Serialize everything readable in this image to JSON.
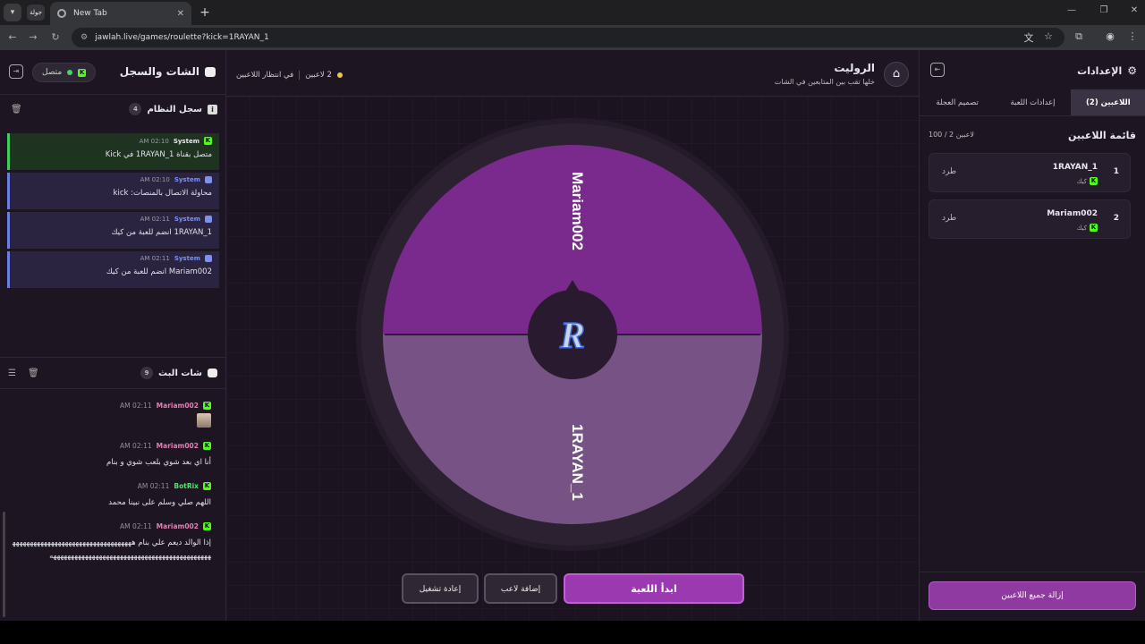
{
  "browser": {
    "pinned_tab_label": "جولة",
    "tab_title": "New Tab",
    "url": "jawlah.live/games/roulette?kick=1RAYAN_1"
  },
  "chat_panel": {
    "title": "الشات والسجل",
    "status": "متصل",
    "system_log": {
      "title": "سجل النظام",
      "count": "4",
      "messages": [
        {
          "author": "System",
          "time": "02:10 AM",
          "text": "متصل بقناة 1RAYAN_1 في Kick",
          "type": "success"
        },
        {
          "author": "System",
          "time": "02:10 AM",
          "text": "محاولة الاتصال بالمنصات: kick",
          "type": "info"
        },
        {
          "author": "System",
          "time": "02:11 AM",
          "text": "1RAYAN_1 انضم للعبة من كيك",
          "type": "info"
        },
        {
          "author": "System",
          "time": "02:11 AM",
          "text": "Mariam002 انضم للعبة من كيك",
          "type": "info"
        }
      ]
    },
    "live_chat": {
      "title": "شات البث",
      "count": "9",
      "messages": [
        {
          "author": "Mariam002",
          "time": "02:11 AM",
          "text": "",
          "emote": true
        },
        {
          "author": "Mariam002",
          "time": "02:11 AM",
          "text": "أنا اي بعد شوي بلعب شوي و بنام"
        },
        {
          "author": "BotRix",
          "time": "02:11 AM",
          "text": "اللهم صلي وسلم على نبينا محمد"
        },
        {
          "author": "Mariam002",
          "time": "02:11 AM",
          "text": "إذا الوالد ديعم علي بنام ههههههههههههههههههههههههههههههههههههههههههههههههههههههههههههههههههههههههههههههههه"
        }
      ]
    }
  },
  "center": {
    "title": "الروليت",
    "subtitle": "خلها تقب بين المتابعين في الشات",
    "players_status": "2 لاعبين",
    "waiting_status": "في انتظار اللاعبين",
    "wheel_segments": [
      {
        "label": "Mariam002",
        "color": "#7a2a8c"
      },
      {
        "label": "1RAYAN_1",
        "color": "#775284"
      }
    ],
    "logo_letter": "R",
    "buttons": {
      "start": "ابدأ اللعبة",
      "add_player": "إضافة لاعب",
      "restart": "إعادة تشغيل"
    }
  },
  "settings_panel": {
    "title": "الإعدادات",
    "tabs": [
      "اللاعبين (2)",
      "إعدادات اللعبة",
      "تصميم العجلة"
    ],
    "players_title": "قائمة اللاعبين",
    "players_count": "100 / 2 لاعبين",
    "players": [
      {
        "number": "1",
        "name": "1RAYAN_1",
        "platform": "كيك",
        "kick_label": "طرد"
      },
      {
        "number": "2",
        "name": "Mariam002",
        "platform": "كيك",
        "kick_label": "طرد"
      }
    ],
    "remove_all": "إزالة جميع اللاعبين"
  },
  "colors": {
    "accent": "#9b3ab0",
    "kick_green": "#53fc18",
    "system_blue": "#7d8ff0"
  }
}
